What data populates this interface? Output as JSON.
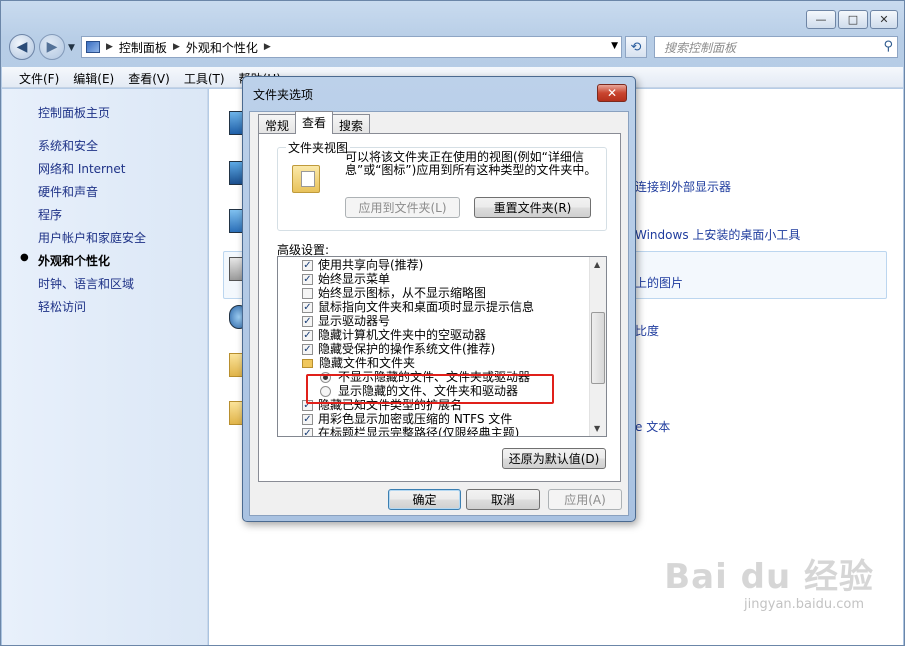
{
  "window": {
    "caption_buttons": {
      "minimize": "—",
      "maximize": "□",
      "close": "✕"
    },
    "breadcrumb": [
      "控制面板",
      "外观和个性化"
    ],
    "search_placeholder": "搜索控制面板"
  },
  "menubar": [
    "文件(F)",
    "编辑(E)",
    "查看(V)",
    "工具(T)",
    "帮助(H)"
  ],
  "sidebar": {
    "home": "控制面板主页",
    "items": [
      "系统和安全",
      "网络和 Internet",
      "硬件和声音",
      "程序",
      "用户帐户和家庭安全",
      "外观和个性化",
      "时钟、语言和区域",
      "轻松访问"
    ],
    "active_index": 5
  },
  "content_links": {
    "link1": "连接到外部显示器",
    "link2": "Windows 上安装的桌面小工具",
    "link3": "上的图片",
    "link4": "比度",
    "link5": "e 文本"
  },
  "watermark": {
    "brand": "Bai du 经验",
    "url": "jingyan.baidu.com"
  },
  "dialog": {
    "title": "文件夹选项",
    "close": "✕",
    "tabs": [
      "常规",
      "查看",
      "搜索"
    ],
    "active_tab": 1,
    "folder_view": {
      "title": "文件夹视图",
      "description": "可以将该文件夹正在使用的视图(例如“详细信息”或“图标”)应用到所有这种类型的文件夹中。",
      "apply_button": "应用到文件夹(L)",
      "reset_button": "重置文件夹(R)"
    },
    "advanced_label": "高级设置:",
    "advanced_items": [
      {
        "type": "checkbox",
        "checked": true,
        "label": "使用共享向导(推荐)"
      },
      {
        "type": "checkbox",
        "checked": true,
        "label": "始终显示菜单"
      },
      {
        "type": "checkbox",
        "checked": false,
        "label": "始终显示图标，从不显示缩略图"
      },
      {
        "type": "checkbox",
        "checked": true,
        "label": "鼠标指向文件夹和桌面项时显示提示信息"
      },
      {
        "type": "checkbox",
        "checked": true,
        "label": "显示驱动器号"
      },
      {
        "type": "checkbox",
        "checked": true,
        "label": "隐藏计算机文件夹中的空驱动器"
      },
      {
        "type": "checkbox",
        "checked": true,
        "label": "隐藏受保护的操作系统文件(推荐)"
      },
      {
        "type": "folder",
        "label": "隐藏文件和文件夹"
      },
      {
        "type": "radio",
        "checked": true,
        "label": "不显示隐藏的文件、文件夹或驱动器"
      },
      {
        "type": "radio",
        "checked": false,
        "label": "显示隐藏的文件、文件夹和驱动器"
      },
      {
        "type": "checkbox",
        "checked": true,
        "label": "隐藏已知文件类型的扩展名"
      },
      {
        "type": "checkbox",
        "checked": true,
        "label": "用彩色显示加密或压缩的 NTFS 文件"
      },
      {
        "type": "checkbox",
        "checked": true,
        "label": "在标题栏显示完整路径(仅限经典主题)"
      }
    ],
    "restore_button": "还原为默认值(D)",
    "ok_button": "确定",
    "cancel_button": "取消",
    "apply_button": "应用(A)"
  },
  "colors": {
    "highlight_box": "#e0201a",
    "link": "#1e3287",
    "title_gradient_top": "#c9dbef"
  }
}
